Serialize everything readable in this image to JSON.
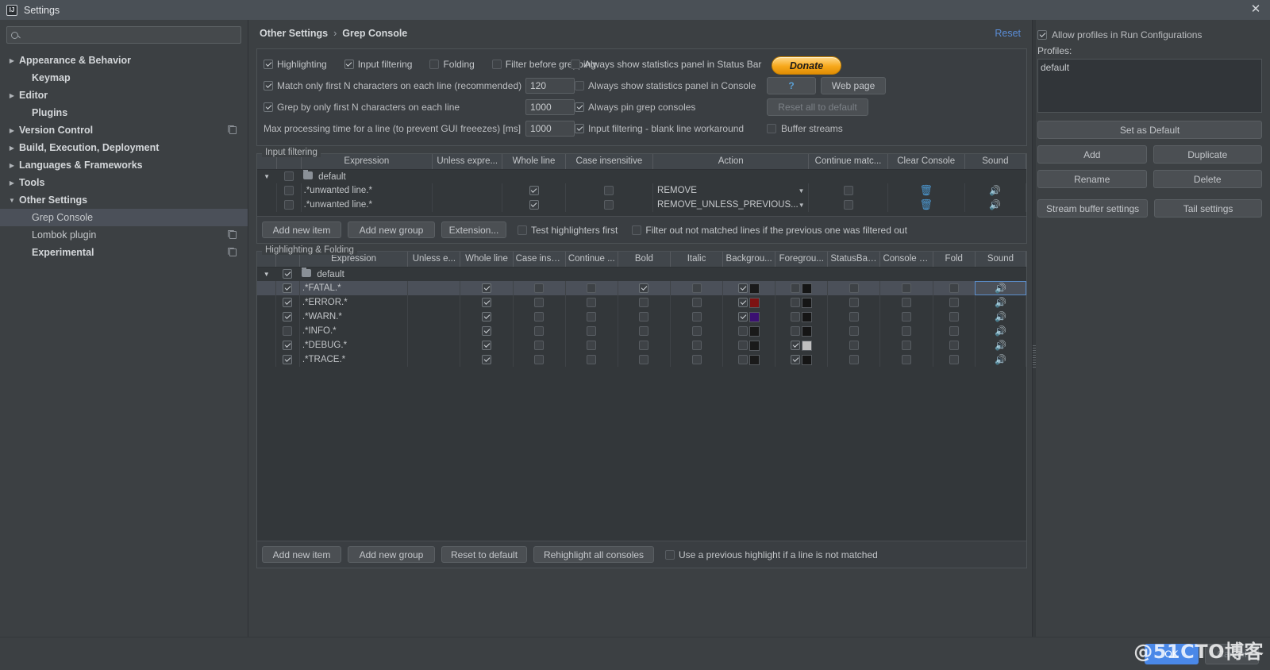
{
  "window": {
    "title": "Settings",
    "logo_text": "IJ",
    "close_icon": "✕"
  },
  "sidebar": {
    "search": {
      "value": "",
      "placeholder": ""
    },
    "items": [
      {
        "label": "Appearance & Behavior",
        "arrow": "▶",
        "bold": true,
        "indent": false,
        "selected": false,
        "copy": false
      },
      {
        "label": "Keymap",
        "arrow": "",
        "bold": true,
        "indent": true,
        "selected": false,
        "copy": false
      },
      {
        "label": "Editor",
        "arrow": "▶",
        "bold": true,
        "indent": false,
        "selected": false,
        "copy": false
      },
      {
        "label": "Plugins",
        "arrow": "",
        "bold": true,
        "indent": true,
        "selected": false,
        "copy": false
      },
      {
        "label": "Version Control",
        "arrow": "▶",
        "bold": true,
        "indent": false,
        "selected": false,
        "copy": true
      },
      {
        "label": "Build, Execution, Deployment",
        "arrow": "▶",
        "bold": true,
        "indent": false,
        "selected": false,
        "copy": false
      },
      {
        "label": "Languages & Frameworks",
        "arrow": "▶",
        "bold": true,
        "indent": false,
        "selected": false,
        "copy": false
      },
      {
        "label": "Tools",
        "arrow": "▶",
        "bold": true,
        "indent": false,
        "selected": false,
        "copy": false
      },
      {
        "label": "Other Settings",
        "arrow": "▼",
        "bold": true,
        "indent": false,
        "selected": false,
        "copy": false
      },
      {
        "label": "Grep Console",
        "arrow": "",
        "bold": false,
        "indent": true,
        "selected": true,
        "copy": false
      },
      {
        "label": "Lombok plugin",
        "arrow": "",
        "bold": false,
        "indent": true,
        "selected": false,
        "copy": true
      },
      {
        "label": "Experimental",
        "arrow": "",
        "bold": true,
        "indent": true,
        "selected": false,
        "copy": true
      }
    ],
    "help_icon": "?"
  },
  "breadcrumb": {
    "root": "Other Settings",
    "separator": "›",
    "current": "Grep Console",
    "reset_label": "Reset"
  },
  "options": {
    "row1": [
      {
        "label": "Highlighting",
        "checked": true
      },
      {
        "label": "Input filtering",
        "checked": true
      },
      {
        "label": "Folding",
        "checked": false
      },
      {
        "label": "Filter before grepping",
        "checked": false
      }
    ],
    "match_first_n": {
      "label": "Match only first N characters on each line (recommended)",
      "checked": true,
      "value": "120"
    },
    "grep_first_n": {
      "label": "Grep by only first N characters on each line",
      "checked": true,
      "value": "1000"
    },
    "max_time": {
      "label": "Max processing time for a line (to prevent GUI freeezes) [ms]",
      "value": "1000"
    },
    "stats_status_bar": {
      "label": "Always show statistics panel in Status Bar",
      "checked": false
    },
    "stats_console": {
      "label": "Always show statistics panel in Console",
      "checked": false
    },
    "pin_consoles": {
      "label": "Always pin grep consoles",
      "checked": true
    },
    "blank_line": {
      "label": "Input filtering - blank line workaround",
      "checked": true
    },
    "buffer_streams": {
      "label": "Buffer streams",
      "checked": false
    },
    "donate_label": "Donate",
    "help_label": "?",
    "web_page_label": "Web page",
    "reset_all_label": "Reset all to default"
  },
  "input_filtering": {
    "legend": "Input filtering",
    "columns": [
      "",
      "",
      "Expression",
      "Unless expre...",
      "Whole line",
      "Case insensitive",
      "Action",
      "Continue matc...",
      "Clear Console",
      "Sound"
    ],
    "group": {
      "name": "default",
      "expanded_icon": "▼",
      "checked": false
    },
    "rows": [
      {
        "enabled": false,
        "expression": ".*unwanted line.*",
        "unless": "",
        "whole_line": true,
        "case_insensitive": false,
        "action": "REMOVE",
        "continue_matching": false,
        "clear_console": "🗑",
        "sound": "speaker-icon"
      },
      {
        "enabled": false,
        "expression": ".*unwanted line.*",
        "unless": "",
        "whole_line": true,
        "case_insensitive": false,
        "action": "REMOVE_UNLESS_PREVIOUS...",
        "continue_matching": false,
        "clear_console": "🗑",
        "sound": "speaker-icon"
      }
    ],
    "footer": {
      "add_item": "Add new item",
      "add_group": "Add new group",
      "extension": "Extension...",
      "test_highlighters": {
        "label": "Test highlighters first",
        "checked": false
      },
      "filter_out": {
        "label": "Filter out not matched lines if the previous one was filtered out",
        "checked": false
      }
    }
  },
  "highlighting": {
    "legend": "Highlighting & Folding",
    "columns": [
      "",
      "",
      "Expression",
      "Unless e...",
      "Whole line",
      "Case inse...",
      "Continue ...",
      "Bold",
      "Italic",
      "Backgrou...",
      "Foregrou...",
      "StatusBar...",
      "Console c...",
      "Fold",
      "Sound"
    ],
    "group": {
      "name": "default",
      "expanded_icon": "▼",
      "checked": true
    },
    "rows": [
      {
        "enabled": true,
        "expression": ".*FATAL.*",
        "unless": "",
        "whole_line": true,
        "case_insensitive": false,
        "continue_matching": false,
        "bold": true,
        "italic": false,
        "background": {
          "checked": true,
          "color": "#1a1a1a"
        },
        "foreground": {
          "checked": false,
          "color": "#151515"
        },
        "statusbar": false,
        "console": false,
        "fold": false,
        "sound": "speaker-icon",
        "selected": true
      },
      {
        "enabled": true,
        "expression": ".*ERROR.*",
        "unless": "",
        "whole_line": true,
        "case_insensitive": false,
        "continue_matching": false,
        "bold": false,
        "italic": false,
        "background": {
          "checked": true,
          "color": "#7d1212"
        },
        "foreground": {
          "checked": false,
          "color": "#151515"
        },
        "statusbar": false,
        "console": false,
        "fold": false,
        "sound": "speaker-icon",
        "selected": false
      },
      {
        "enabled": true,
        "expression": ".*WARN.*",
        "unless": "",
        "whole_line": true,
        "case_insensitive": false,
        "continue_matching": false,
        "bold": false,
        "italic": false,
        "background": {
          "checked": true,
          "color": "#3b1072"
        },
        "foreground": {
          "checked": false,
          "color": "#151515"
        },
        "statusbar": false,
        "console": false,
        "fold": false,
        "sound": "speaker-icon",
        "selected": false
      },
      {
        "enabled": false,
        "expression": ".*INFO.*",
        "unless": "",
        "whole_line": true,
        "case_insensitive": false,
        "continue_matching": false,
        "bold": false,
        "italic": false,
        "background": {
          "checked": false,
          "color": "#1a1a1a"
        },
        "foreground": {
          "checked": false,
          "color": "#151515"
        },
        "statusbar": false,
        "console": false,
        "fold": false,
        "sound": "speaker-icon",
        "selected": false
      },
      {
        "enabled": true,
        "expression": ".*DEBUG.*",
        "unless": "",
        "whole_line": true,
        "case_insensitive": false,
        "continue_matching": false,
        "bold": false,
        "italic": false,
        "background": {
          "checked": false,
          "color": "#1a1a1a"
        },
        "foreground": {
          "checked": true,
          "color": "#bfbfbf"
        },
        "statusbar": false,
        "console": false,
        "fold": false,
        "sound": "speaker-icon",
        "selected": false
      },
      {
        "enabled": true,
        "expression": ".*TRACE.*",
        "unless": "",
        "whole_line": true,
        "case_insensitive": false,
        "continue_matching": false,
        "bold": false,
        "italic": false,
        "background": {
          "checked": false,
          "color": "#1a1a1a"
        },
        "foreground": {
          "checked": true,
          "color": "#151515"
        },
        "statusbar": false,
        "console": false,
        "fold": false,
        "sound": "speaker-icon",
        "selected": false
      }
    ],
    "footer": {
      "add_item": "Add new item",
      "add_group": "Add new group",
      "reset_default": "Reset to default",
      "rehighlight": "Rehighlight all consoles",
      "use_previous": {
        "label": "Use a previous highlight if a line is not matched",
        "checked": false
      }
    }
  },
  "profiles": {
    "allow_in_run_configs": {
      "label": "Allow profiles in Run Configurations",
      "checked": true
    },
    "list_label": "Profiles:",
    "items": [
      "default"
    ],
    "set_as_default": "Set as Default",
    "add": "Add",
    "duplicate": "Duplicate",
    "rename": "Rename",
    "delete": "Delete",
    "stream_buffer": "Stream buffer settings",
    "tail_settings": "Tail settings"
  },
  "footer": {
    "ok": "OK",
    "cancel": "Cancel",
    "watermark": "@51CTO博客"
  }
}
